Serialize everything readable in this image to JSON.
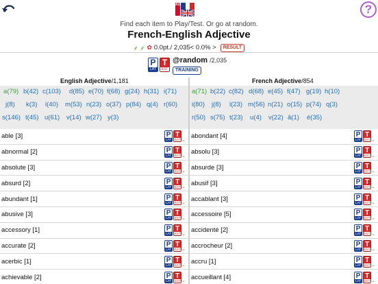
{
  "header": {
    "instruction": "Find each item to Play/Test. Or go at random.",
    "title": "French-English Adjective",
    "score": "0.0pt./ 2,035< 0.0% >",
    "result_label": "RESULT",
    "flag_auto": "AUTO",
    "help_label": "?"
  },
  "random": {
    "label": "@random",
    "count": "/2,035",
    "training_label": "TRAINING"
  },
  "icons": {
    "p": "P",
    "p_sub": "LAT",
    "t": "T",
    "t_sub": "EST"
  },
  "columns": {
    "left": {
      "title": "English Adjective",
      "count": "/1,181"
    },
    "right": {
      "title": "French Adjective",
      "count": "/854"
    }
  },
  "left_letters": [
    [
      "a(79)",
      "b(42)",
      "c(103)",
      "d(85)",
      "e(70)",
      "f(68)",
      "g(24)",
      "h(31)",
      "i(71)"
    ],
    [
      "j(8)",
      "k(3)",
      "l(40)",
      "m(53)",
      "n(23)",
      "o(37)",
      "p(84)",
      "q(4)",
      "r(60)"
    ],
    [
      "s(146)",
      "t(45)",
      "u(61)",
      "v(14)",
      "w(27)",
      "y(3)"
    ]
  ],
  "right_letters": [
    [
      "a(71)",
      "b(22)",
      "c(82)",
      "d(68)",
      "e(45)",
      "f(47)",
      "g(19)",
      "h(10)"
    ],
    [
      "i(80)",
      "j(8)",
      "l(23)",
      "m(56)",
      "n(21)",
      "o(15)",
      "p(74)",
      "q(3)"
    ],
    [
      "r(50)",
      "s(75)",
      "t(23)",
      "u(4)",
      "v(22)",
      "â(1)",
      "é(35)"
    ]
  ],
  "left_words": [
    "able [3]",
    "abnormal [2]",
    "absolute [3]",
    "absurd [2]",
    "abundant [1]",
    "abusive [3]",
    "accessory [1]",
    "accurate [2]",
    "acerbic [1]",
    "achievable [2]"
  ],
  "right_words": [
    "abondant [4]",
    "absolu [3]",
    "absurde [3]",
    "abusif [3]",
    "accablant [3]",
    "accessoire [5]",
    "accidenté [2]",
    "accrocheur [2]",
    "accru [1]",
    "accueillant [4]"
  ],
  "colors": {
    "link": "#1f6fbf",
    "active_letter": "#3aa13a",
    "accent_red": "#d62828",
    "accent_blue": "#1a3d8f",
    "help_purple": "#b05cc8"
  }
}
